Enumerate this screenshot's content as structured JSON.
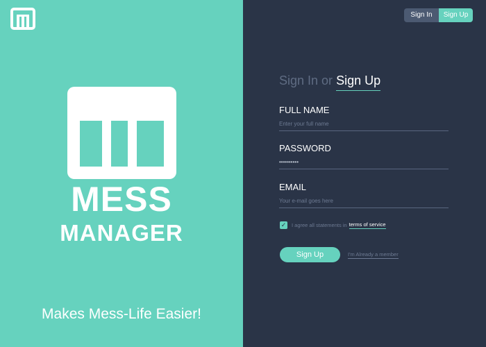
{
  "colors": {
    "accent": "#66d2be",
    "panel_dark": "#2a3447",
    "muted_text": "#5f6c83",
    "switch_inactive": "#4c5a72"
  },
  "brand": {
    "logo_icon": "mess-manager-logo-icon",
    "line1": "MESS",
    "line2": "MANAGER",
    "tagline": "Makes Mess-Life Easier!"
  },
  "top_switch": {
    "sign_in": "Sign In",
    "sign_up": "Sign Up",
    "active": "Sign Up"
  },
  "form_tabs": {
    "sign_in": "Sign In",
    "or": "or",
    "sign_up": "Sign Up",
    "active": "Sign Up"
  },
  "fields": {
    "full_name": {
      "label": "FULL NAME",
      "placeholder": "Enter your full name",
      "value": ""
    },
    "password": {
      "label": "PASSWORD",
      "value": "••••••••••"
    },
    "email": {
      "label": "EMAIL",
      "placeholder": "Your e-mail goes here",
      "value": ""
    }
  },
  "agreement": {
    "checked": true,
    "text": "I agree all statements in",
    "link": "terms of service"
  },
  "actions": {
    "submit": "Sign Up",
    "member_link": "I'm Already a member"
  }
}
